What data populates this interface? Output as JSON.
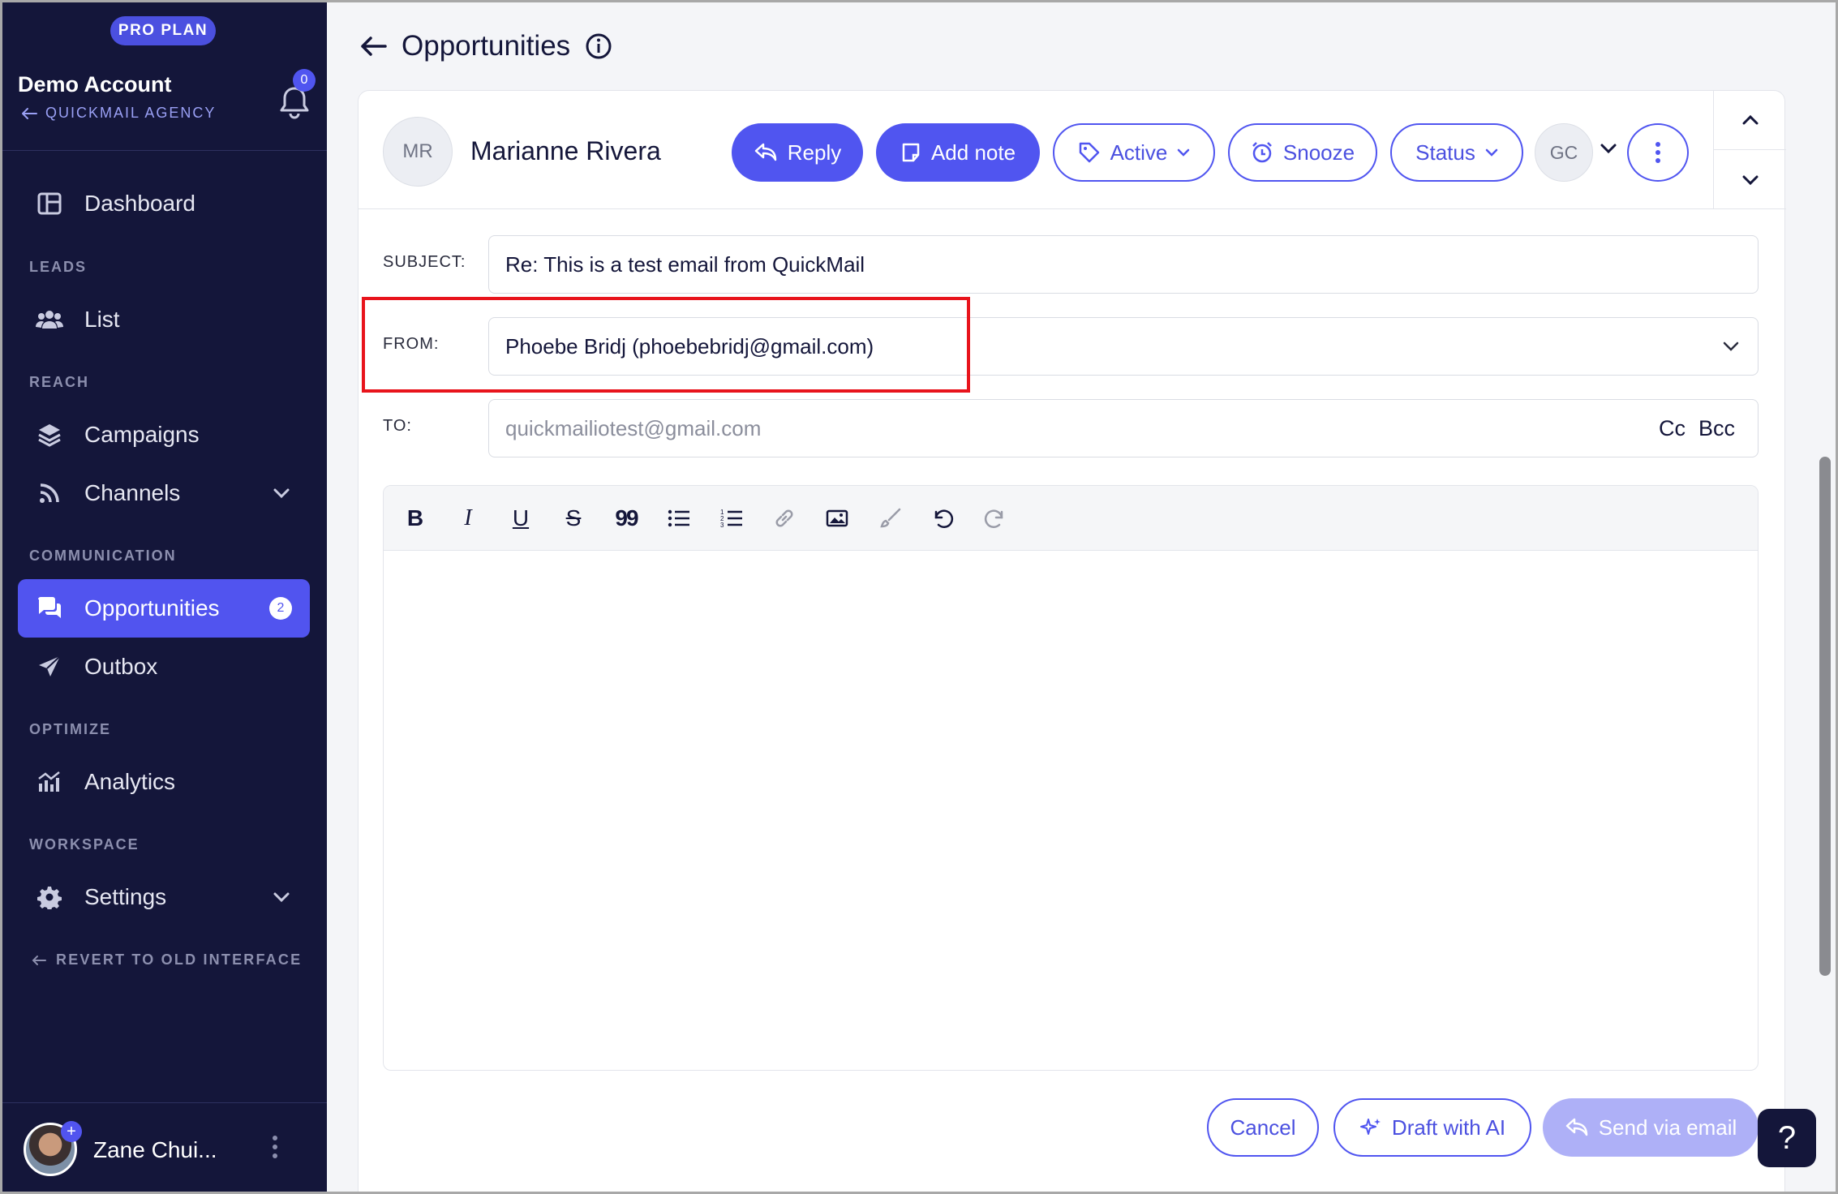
{
  "sidebar": {
    "plan_badge": "PRO PLAN",
    "account_name": "Demo Account",
    "agency_link": "QUICKMAIL AGENCY",
    "notification_count": "0",
    "sections": {
      "leads": "LEADS",
      "reach": "REACH",
      "communication": "COMMUNICATION",
      "optimize": "OPTIMIZE",
      "workspace": "WORKSPACE"
    },
    "items": {
      "dashboard": "Dashboard",
      "list": "List",
      "campaigns": "Campaigns",
      "channels": "Channels",
      "opportunities": "Opportunities",
      "opportunities_badge": "2",
      "outbox": "Outbox",
      "analytics": "Analytics",
      "settings": "Settings"
    },
    "revert_link": "REVERT TO OLD INTERFACE",
    "user_name": "Zane Chui...",
    "avatar_plus": "+"
  },
  "header": {
    "title": "Opportunities"
  },
  "lead": {
    "initials": "MR",
    "name": "Marianne Rivera",
    "assignee_initials": "GC"
  },
  "actions": {
    "reply": "Reply",
    "add_note": "Add note",
    "active": "Active",
    "snooze": "Snooze",
    "status": "Status"
  },
  "compose": {
    "subject_label": "SUBJECT:",
    "subject_value": "Re: This is a test email from QuickMail",
    "from_label": "FROM:",
    "from_value": "Phoebe Bridj (phoebebridj@gmail.com)",
    "to_label": "TO:",
    "to_placeholder": "quickmailiotest@gmail.com",
    "cc": "Cc",
    "bcc": "Bcc"
  },
  "toolbar": {
    "bold": "B",
    "italic": "I",
    "underline": "U",
    "strike": "S",
    "quote": "99"
  },
  "footer": {
    "cancel": "Cancel",
    "draft_ai": "Draft with AI",
    "send": "Send via email",
    "help": "?"
  },
  "colors": {
    "sidebar_bg": "#14163a",
    "accent": "#5055f0",
    "highlight": "#e8141c"
  }
}
